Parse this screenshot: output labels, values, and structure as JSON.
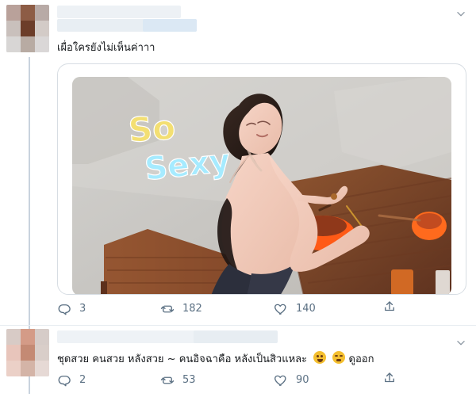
{
  "tweet_1": {
    "text": "เผื่อใครยังไม่เห็นค่าาา",
    "media": {
      "overlay_line_1": "So",
      "overlay_line_2": "Sexy"
    },
    "actions": {
      "reply_count": "3",
      "retweet_count": "182",
      "like_count": "140"
    },
    "icons": {
      "reply": "reply-icon",
      "retweet": "retweet-icon",
      "like": "heart-icon",
      "share": "share-icon",
      "menu": "chevron-down-icon"
    }
  },
  "tweet_2": {
    "text_main": "ชุดสวย คนสวย หลังสวย ~ คนอิจฉาคือ หลังเป็นสิวแหละ",
    "text_tail": "ดูออก",
    "actions": {
      "reply_count": "2",
      "retweet_count": "53",
      "like_count": "90"
    },
    "icons": {
      "reply": "reply-icon",
      "retweet": "retweet-icon",
      "like": "heart-icon",
      "share": "share-icon",
      "menu": "chevron-down-icon",
      "emoji_1": "tired-face-emoji",
      "emoji_2": "angry-face-emoji"
    }
  },
  "colors": {
    "text": "#14171a",
    "muted": "#5b7083",
    "border": "#d7dde3",
    "thread_line": "#c9d3de",
    "overlay_yellow": "#f2df73",
    "overlay_blue": "#9be5ff"
  }
}
